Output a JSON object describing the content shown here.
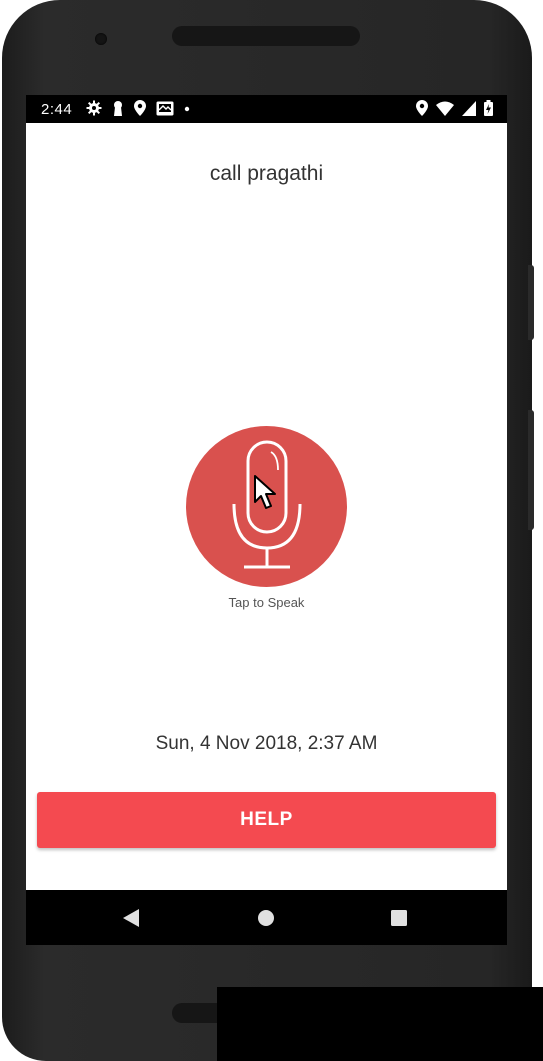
{
  "status_bar": {
    "time": "2:44",
    "left_icons": [
      "settings-icon",
      "keyhole-icon",
      "location-icon",
      "photo-message-icon",
      "notification-dot-icon"
    ],
    "right_icons": [
      "location-icon",
      "wifi-icon",
      "signal-icon",
      "battery-icon"
    ]
  },
  "main": {
    "title": "call pragathi",
    "mic_label": "Tap to Speak",
    "datetime": "Sun, 4 Nov 2018, 2:37 AM",
    "help_button_label": "HELP"
  },
  "nav_bar": {
    "buttons": [
      "back-icon",
      "home-icon",
      "recents-icon"
    ]
  },
  "colors": {
    "mic_background": "#d9514e",
    "help_button": "#f44a50",
    "status_bar": "#000000",
    "nav_bar": "#000000"
  }
}
